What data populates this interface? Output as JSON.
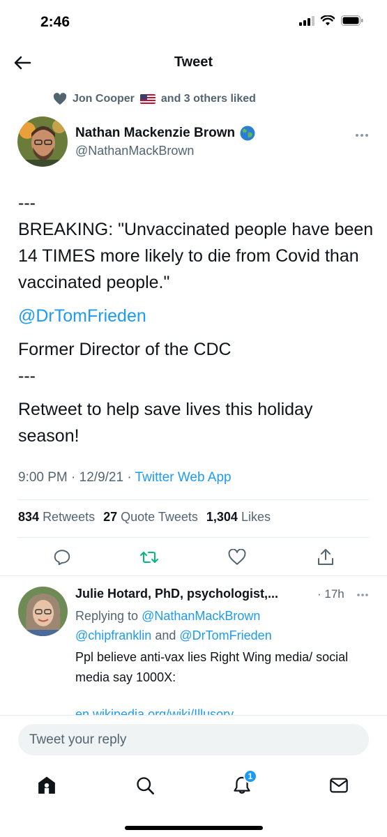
{
  "status_bar": {
    "time": "2:46"
  },
  "header": {
    "title": "Tweet",
    "back_icon": "arrow-left-icon"
  },
  "social_context": {
    "liked_by": "Jon Cooper",
    "suffix": "and 3 others liked"
  },
  "tweet": {
    "author_name": "Nathan Mackenzie Brown",
    "author_handle": "@NathanMackBrown",
    "lines": {
      "dashes_top": "---",
      "breaking": "BREAKING: \"Unvaccinated people have been 14 TIMES more likely to die from Covid than vaccinated people.\"",
      "mention": "@DrTomFrieden",
      "attribution": "Former Director of the CDC",
      "dashes_bottom": "---",
      "cta": "Retweet to help save lives this holiday season!"
    },
    "time": "9:00 PM",
    "date": "12/9/21",
    "separator": "·",
    "source": "Twitter Web App",
    "stats": {
      "retweets_count": "834",
      "retweets_label": "Retweets",
      "quotes_count": "27",
      "quotes_label": "Quote Tweets",
      "likes_count": "1,304",
      "likes_label": "Likes"
    }
  },
  "reply": {
    "author_name": "Julie Hotard, PhD, psychologist,...",
    "time": "· 17h",
    "replying_prefix": "Replying to",
    "replying_to_1": "@NathanMackBrown",
    "replying_to_2": "@chipfranklin",
    "replying_and": "and",
    "replying_to_3": "@DrTomFrieden",
    "text": "Ppl believe anti-vax lies Right Wing media/ social media  say 1000X:",
    "link": "en.wikipedia.org/wiki/Illusory..."
  },
  "compose": {
    "placeholder": "Tweet your reply"
  },
  "tabbar": {
    "notification_count": "1"
  },
  "colors": {
    "accent": "#1d9bf0",
    "retweet_green": "#00ba7c",
    "secondary_text": "#536471"
  }
}
